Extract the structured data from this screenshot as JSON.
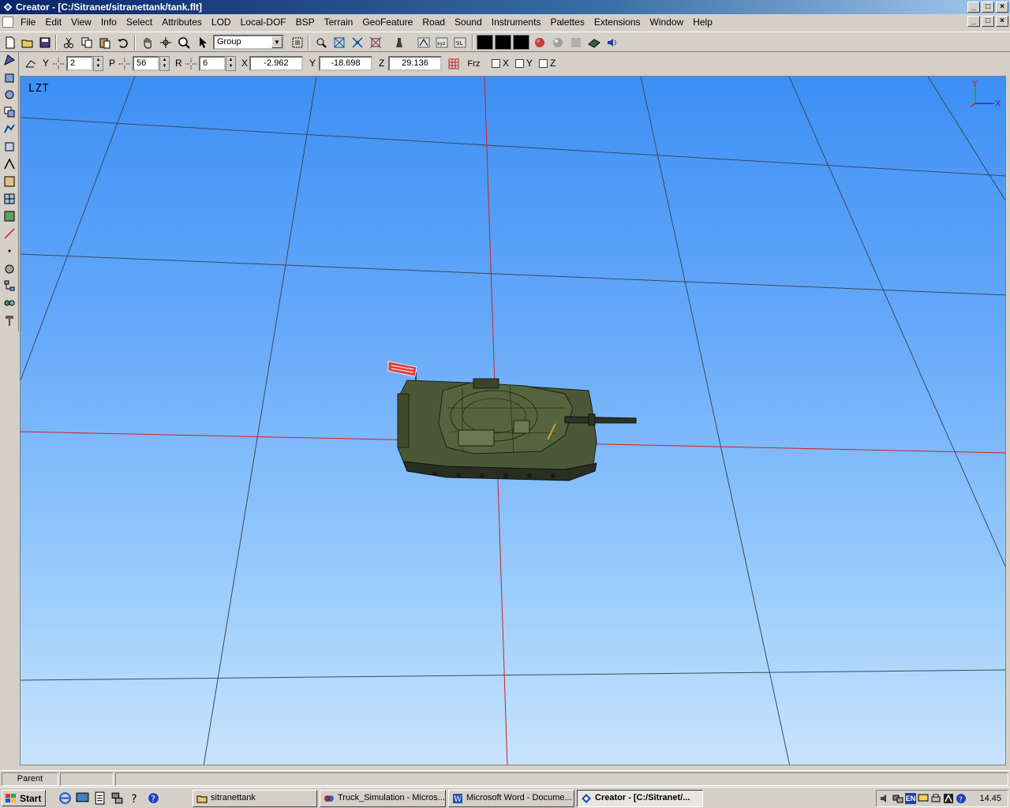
{
  "window": {
    "title": "Creator - [C:/Sitranet/sitranettank/tank.flt]",
    "controls": {
      "minimize": "_",
      "maximize": "□",
      "close": "×"
    }
  },
  "menu": {
    "items": [
      "File",
      "Edit",
      "View",
      "Info",
      "Select",
      "Attributes",
      "LOD",
      "Local-DOF",
      "BSP",
      "Terrain",
      "GeoFeature",
      "Road",
      "Sound",
      "Instruments",
      "Palettes",
      "Extensions",
      "Window",
      "Help"
    ]
  },
  "toolbar": {
    "select_mode": "Group",
    "icons": [
      "new-icon",
      "open-icon",
      "save-icon",
      "cut-icon",
      "copy-icon",
      "paste-icon",
      "undo-icon",
      "pan-hand-icon",
      "move-icon",
      "zoom-icon",
      "pointer-icon"
    ]
  },
  "transform": {
    "y_label": "Y",
    "y_value": "2",
    "p_label": "P",
    "p_value": "56",
    "r_label": "R",
    "r_value": "6",
    "x_label": "X",
    "x_value": "-2.962",
    "y2_label": "Y",
    "y2_value": "-18.698",
    "z_label": "Z",
    "z_value": "29.136",
    "frz_label": "Frz",
    "lock_x": "X",
    "lock_y": "Y",
    "lock_z": "Z"
  },
  "viewport": {
    "view_label": "LZT",
    "axis_x": "X",
    "axis_y": "Y",
    "background_top": "#3d8ff5",
    "background_bottom": "#c8e4fd",
    "grid_color": "#3a4a5a",
    "axis_line_color": "#d02020"
  },
  "status": {
    "pane1": "Parent",
    "pane2": ""
  },
  "taskbar": {
    "start": "Start",
    "tasks": [
      {
        "label": "sitranettank",
        "active": false
      },
      {
        "label": "Truck_Simulation - Micros...",
        "active": false
      },
      {
        "label": "Microsoft Word - Docume...",
        "active": false
      },
      {
        "label": "Creator - [C:/Sitranet/...",
        "active": true
      }
    ],
    "tray_lang": "EN",
    "clock": "14.45"
  }
}
